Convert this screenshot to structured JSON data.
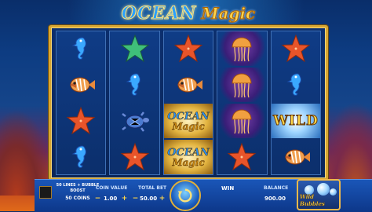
{
  "logo": {
    "word1": "OCEAN",
    "word2": "Magic"
  },
  "reels": [
    [
      {
        "symbol": "seahorse-icon"
      },
      {
        "symbol": "fish-icon"
      },
      {
        "symbol": "starfish-icon"
      },
      {
        "symbol": "seahorse-icon"
      }
    ],
    [
      {
        "symbol": "starfish-green-icon"
      },
      {
        "symbol": "seahorse-icon"
      },
      {
        "symbol": "turtle-icon"
      },
      {
        "symbol": "starfish-icon"
      }
    ],
    [
      {
        "symbol": "starfish-icon"
      },
      {
        "symbol": "fish-icon"
      },
      {
        "symbol": "ocean-magic-logo",
        "text1": "OCEAN",
        "text2": "Magic"
      },
      {
        "symbol": "ocean-magic-logo",
        "text1": "OCEAN",
        "text2": "Magic"
      }
    ],
    [
      {
        "symbol": "jellyfish-icon"
      },
      {
        "symbol": "jellyfish-icon"
      },
      {
        "symbol": "jellyfish-icon"
      },
      {
        "symbol": "starfish-icon"
      }
    ],
    [
      {
        "symbol": "starfish-icon"
      },
      {
        "symbol": "seahorse-icon"
      },
      {
        "symbol": "wild-symbol",
        "text": "WILD"
      },
      {
        "symbol": "fish-icon"
      }
    ]
  ],
  "controls": {
    "lines_text": "50 LINES + BUBBLE BOOST",
    "coins_text": "50 COINS",
    "coin_value_label": "COIN VALUE",
    "coin_value": "1.00",
    "total_bet_label": "TOTAL BET",
    "total_bet": "50.00",
    "win_label": "WIN",
    "balance_label": "BALANCE",
    "balance": "900.00",
    "minus": "−",
    "plus": "+"
  },
  "feature": {
    "label": "Wild Bubbles"
  },
  "colors": {
    "frame_gold": "#d7a632",
    "bar_blue": "#1a56b8",
    "accent_yellow": "#ffd84a"
  }
}
